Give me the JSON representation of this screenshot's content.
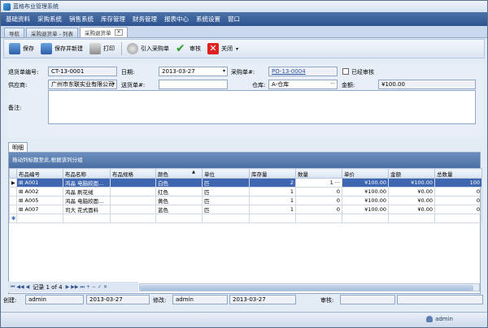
{
  "app": {
    "title": "蓝格布业管理系统"
  },
  "menu": [
    "基础资料",
    "采购系统",
    "销售系统",
    "库存管理",
    "财务管理",
    "报表中心",
    "系统设置",
    "窗口"
  ],
  "tabs": [
    {
      "label": "导航"
    },
    {
      "label": "采购退货单 - 列表"
    },
    {
      "label": "采购退货单"
    }
  ],
  "toolbar": {
    "save": "保存",
    "save_new": "保存并新建",
    "print": "打印",
    "import": "引入采购单",
    "audit": "审核",
    "close": "关闭"
  },
  "form": {
    "doc_no_label": "退货单编号:",
    "doc_no": "CT-13-0001",
    "date_label": "日期:",
    "date": "2013-03-27",
    "po_label": "采购单#:",
    "po": "PO-13-0004",
    "audited_label": "已经审核",
    "supplier_label": "供应商:",
    "supplier": "广州市东联实业有限公司",
    "shipper_label": "送货单#:",
    "shipper": "",
    "warehouse_label": "仓库:",
    "warehouse": "A-仓库",
    "amount_label": "金额:",
    "amount": "¥100.00",
    "remark_label": "备注:"
  },
  "detail_tab": "明细",
  "grid": {
    "group_hint": "拖动列标题至此,根据该列分组",
    "columns": [
      "布品编号",
      "布品名称",
      "布品规格",
      "颜色",
      "单位",
      "库存量",
      "数量",
      "单价",
      "金额",
      "总数量"
    ],
    "rows": [
      {
        "code": "A001",
        "name": "鸿晶 电脑絞面…",
        "spec": "",
        "color": "白色",
        "unit": "匹",
        "stock": "2",
        "qty": "1",
        "price": "¥100.00",
        "amount": "¥100.00",
        "total": "100"
      },
      {
        "code": "A002",
        "name": "鸿晶 刷花绒",
        "spec": "",
        "color": "红色",
        "unit": "匹",
        "stock": "1",
        "qty": "0",
        "price": "¥100.00",
        "amount": "¥0.00",
        "total": "0"
      },
      {
        "code": "A005",
        "name": "鸿晶 电脑絞面…",
        "spec": "",
        "color": "黄色",
        "unit": "匹",
        "stock": "1",
        "qty": "0",
        "price": "¥100.00",
        "amount": "¥0.00",
        "total": "0"
      },
      {
        "code": "A007",
        "name": "司大 花式面料",
        "spec": "",
        "color": "蓝色",
        "unit": "匹",
        "stock": "1",
        "qty": "0",
        "price": "¥100.00",
        "amount": "¥0.00",
        "total": "0"
      }
    ],
    "pager": "记录 1 of 4"
  },
  "footer": {
    "created_label": "创建:",
    "created_by": "admin",
    "created_date": "2013-03-27",
    "modified_label": "修改:",
    "modified_by": "admin",
    "modified_date": "2013-03-27",
    "audit_label": "审核:"
  },
  "status": {
    "user": "admin"
  }
}
